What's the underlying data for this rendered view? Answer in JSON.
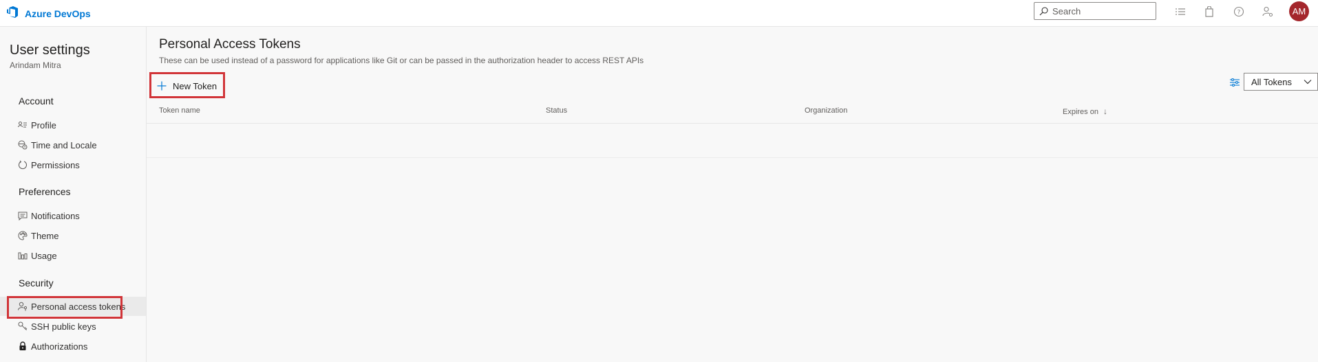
{
  "header": {
    "brand_name": "Azure DevOps",
    "search_placeholder": "Search",
    "icons": [
      "list-icon",
      "shopping-bag-icon",
      "help-icon",
      "user-settings-icon"
    ],
    "avatar_initials": "AM"
  },
  "sidebar": {
    "title": "User settings",
    "user_name": "Arindam Mitra",
    "sections": [
      {
        "heading": "Account",
        "items": [
          {
            "label": "Profile",
            "icon": "profile-card-icon"
          },
          {
            "label": "Time and Locale",
            "icon": "globe-clock-icon"
          },
          {
            "label": "Permissions",
            "icon": "permissions-icon"
          }
        ]
      },
      {
        "heading": "Preferences",
        "items": [
          {
            "label": "Notifications",
            "icon": "chat-icon"
          },
          {
            "label": "Theme",
            "icon": "palette-icon"
          },
          {
            "label": "Usage",
            "icon": "usage-chart-icon"
          }
        ]
      },
      {
        "heading": "Security",
        "items": [
          {
            "label": "Personal access tokens",
            "icon": "person-key-icon",
            "selected": true
          },
          {
            "label": "SSH public keys",
            "icon": "key-icon"
          },
          {
            "label": "Authorizations",
            "icon": "lock-icon"
          }
        ]
      }
    ]
  },
  "main": {
    "title": "Personal Access Tokens",
    "description": "These can be used instead of a password for applications like Git or can be passed in the authorization header to access REST APIs",
    "new_token_label": "New Token",
    "filter_dropdown_value": "All Tokens",
    "table_columns": [
      "Token name",
      "Status",
      "Organization",
      "Expires on"
    ],
    "sort_indicator": "↓"
  },
  "colors": {
    "accent": "#0078d4",
    "avatar_bg": "#a4262c",
    "highlight_box": "#d13438"
  }
}
